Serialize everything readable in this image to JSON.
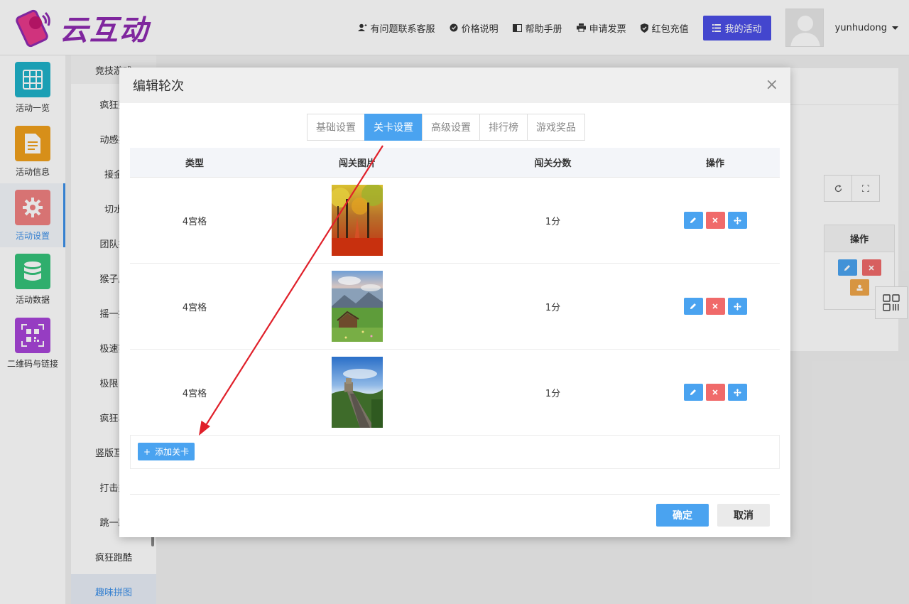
{
  "brand": {
    "name": "云互动"
  },
  "topnav": {
    "links": [
      {
        "label": "有问题联系客服",
        "icon": "user-plus-icon"
      },
      {
        "label": "价格说明",
        "icon": "badge-icon"
      },
      {
        "label": "帮助手册",
        "icon": "book-icon"
      },
      {
        "label": "申请发票",
        "icon": "printer-icon"
      },
      {
        "label": "红包充值",
        "icon": "shield-check-icon"
      }
    ],
    "my_activity": "我的活动",
    "username": "yunhudong"
  },
  "leftnav": {
    "items": [
      {
        "label": "活动一览",
        "icon": "grid-icon",
        "color": "#1fb1c9"
      },
      {
        "label": "活动信息",
        "icon": "document-icon",
        "color": "#f0a01c"
      },
      {
        "label": "活动设置",
        "icon": "gear-icon",
        "color": "#f08080",
        "active": true
      },
      {
        "label": "活动数据",
        "icon": "database-icon",
        "color": "#35c27a"
      },
      {
        "label": "二维码与链接",
        "icon": "qrcode-icon",
        "color": "#a845d8"
      }
    ]
  },
  "submenu": {
    "items": [
      "竞技游戏",
      "疯狂数",
      "动感摇",
      "接金",
      "切水",
      "团队拔",
      "猴子爬",
      "摇一摇",
      "极速赛",
      "极限自",
      "疯狂马",
      "竖版互动",
      "打击类",
      "跳一跳",
      "疯狂跑酷",
      "趣味拼图"
    ],
    "active": "趣味拼图"
  },
  "background": {
    "table_header": "操作"
  },
  "modal": {
    "title": "编辑轮次",
    "tabs": [
      "基础设置",
      "关卡设置",
      "高级设置",
      "排行榜",
      "游戏奖品"
    ],
    "active_tab": "关卡设置",
    "columns": [
      "类型",
      "闯关图片",
      "闯关分数",
      "操作"
    ],
    "rows": [
      {
        "type": "4宫格",
        "image": "autumn-forest",
        "score": "1分"
      },
      {
        "type": "4宫格",
        "image": "mountain-meadow",
        "score": "1分"
      },
      {
        "type": "4宫格",
        "image": "great-wall",
        "score": "1分"
      }
    ],
    "add_button": "添加关卡",
    "ok": "确定",
    "cancel": "取消"
  },
  "colors": {
    "primary": "#4aa3f0",
    "danger": "#f06a6a",
    "accent": "#4b4fe6",
    "arrow": "#e0202a"
  }
}
